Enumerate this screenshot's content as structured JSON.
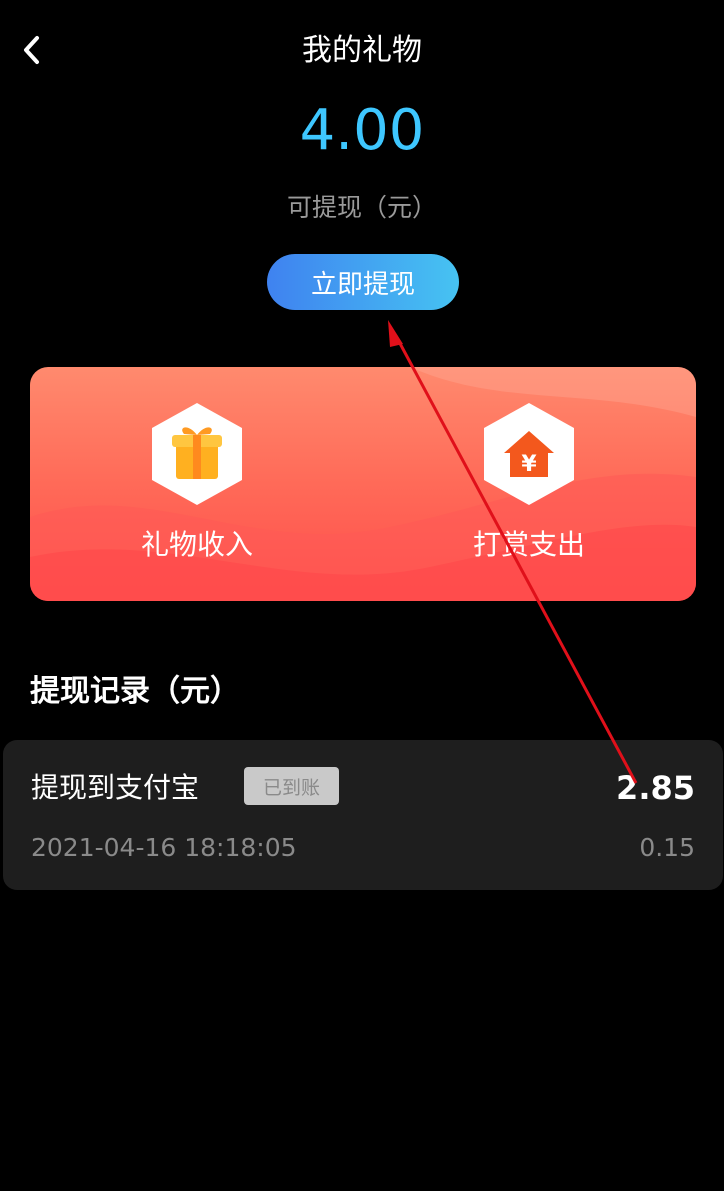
{
  "header": {
    "title": "我的礼物",
    "back_icon": "chevron-left-icon"
  },
  "balance": {
    "amount": "4.00",
    "label": "可提现（元）",
    "amount_color": "#3ec7ff"
  },
  "withdraw_button": {
    "label": "立即提现"
  },
  "card": {
    "items": [
      {
        "label": "礼物收入",
        "icon": "gift-icon"
      },
      {
        "label": "打赏支出",
        "icon": "yuan-house-icon"
      }
    ]
  },
  "records": {
    "title": "提现记录（元）",
    "items": [
      {
        "title": "提现到支付宝",
        "status": "已到账",
        "amount": "2.85",
        "time": "2021-04-16 18:18:05",
        "fee": "0.15"
      }
    ]
  },
  "annotation": {
    "type": "red-arrow",
    "color": "#e0101a"
  }
}
